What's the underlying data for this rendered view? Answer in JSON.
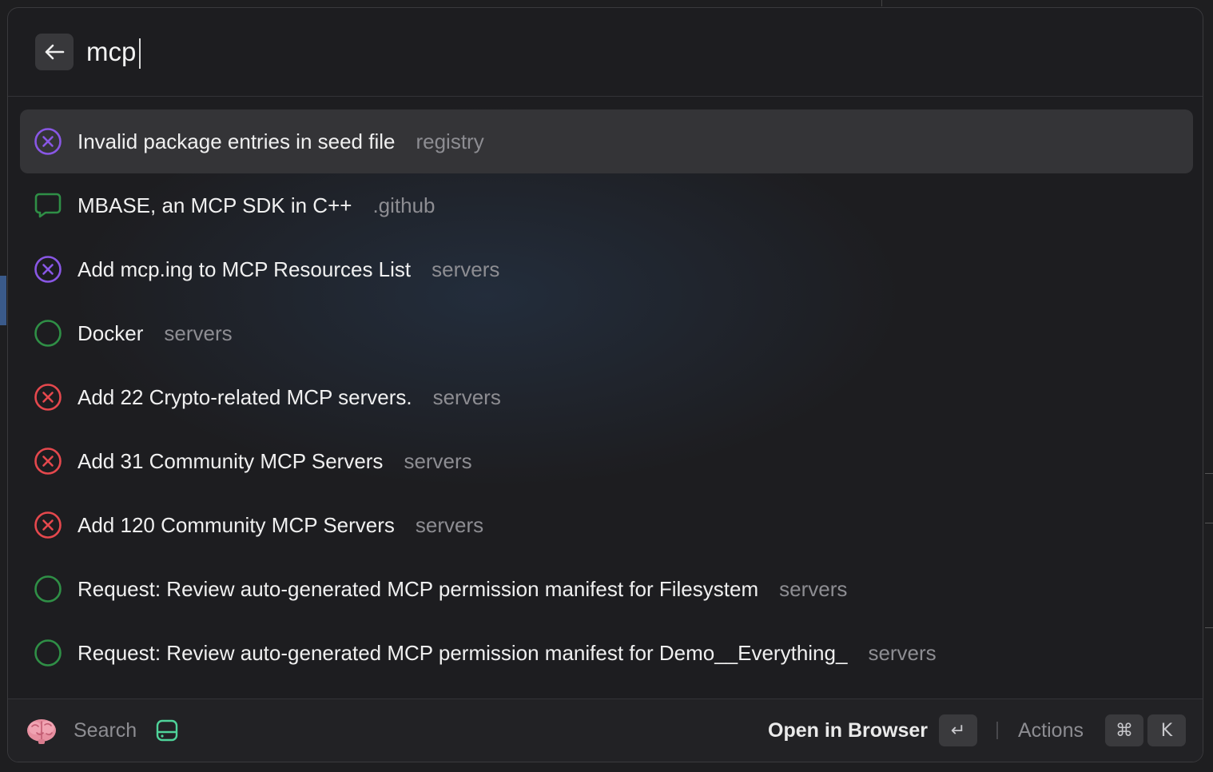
{
  "search": {
    "value": "mcp",
    "placeholder": ""
  },
  "colors": {
    "merged": "#8957e5",
    "open": "#2f8f46",
    "closed": "#e5484d",
    "discussion": "#2f8f46",
    "selected_row": "#343437"
  },
  "results": [
    {
      "title": "Invalid package entries in seed file",
      "repo": "registry",
      "status": "merged",
      "icon": "x-circle-icon"
    },
    {
      "title": "MBASE, an MCP SDK in C++",
      "repo": ".github",
      "status": "discussion",
      "icon": "discussion-icon"
    },
    {
      "title": "Add mcp.ing to MCP Resources List",
      "repo": "servers",
      "status": "merged",
      "icon": "x-circle-icon"
    },
    {
      "title": "Docker",
      "repo": "servers",
      "status": "open",
      "icon": "open-circle-icon"
    },
    {
      "title": "Add 22 Crypto-related MCP servers.",
      "repo": "servers",
      "status": "closed",
      "icon": "x-circle-icon"
    },
    {
      "title": "Add 31 Community MCP Servers",
      "repo": "servers",
      "status": "closed",
      "icon": "x-circle-icon"
    },
    {
      "title": "Add 120 Community MCP Servers",
      "repo": "servers",
      "status": "closed",
      "icon": "x-circle-icon"
    },
    {
      "title": "Request: Review auto-generated MCP permission manifest for Filesystem",
      "repo": "servers",
      "status": "open",
      "icon": "open-circle-icon"
    },
    {
      "title": "Request: Review auto-generated MCP permission manifest for Demo__Everything_",
      "repo": "servers",
      "status": "open",
      "icon": "open-circle-icon"
    }
  ],
  "footer": {
    "search_label": "Search",
    "primary_action": "Open in Browser",
    "enter_key": "↵",
    "actions_label": "Actions",
    "cmd_key": "⌘",
    "k_key": "K"
  }
}
